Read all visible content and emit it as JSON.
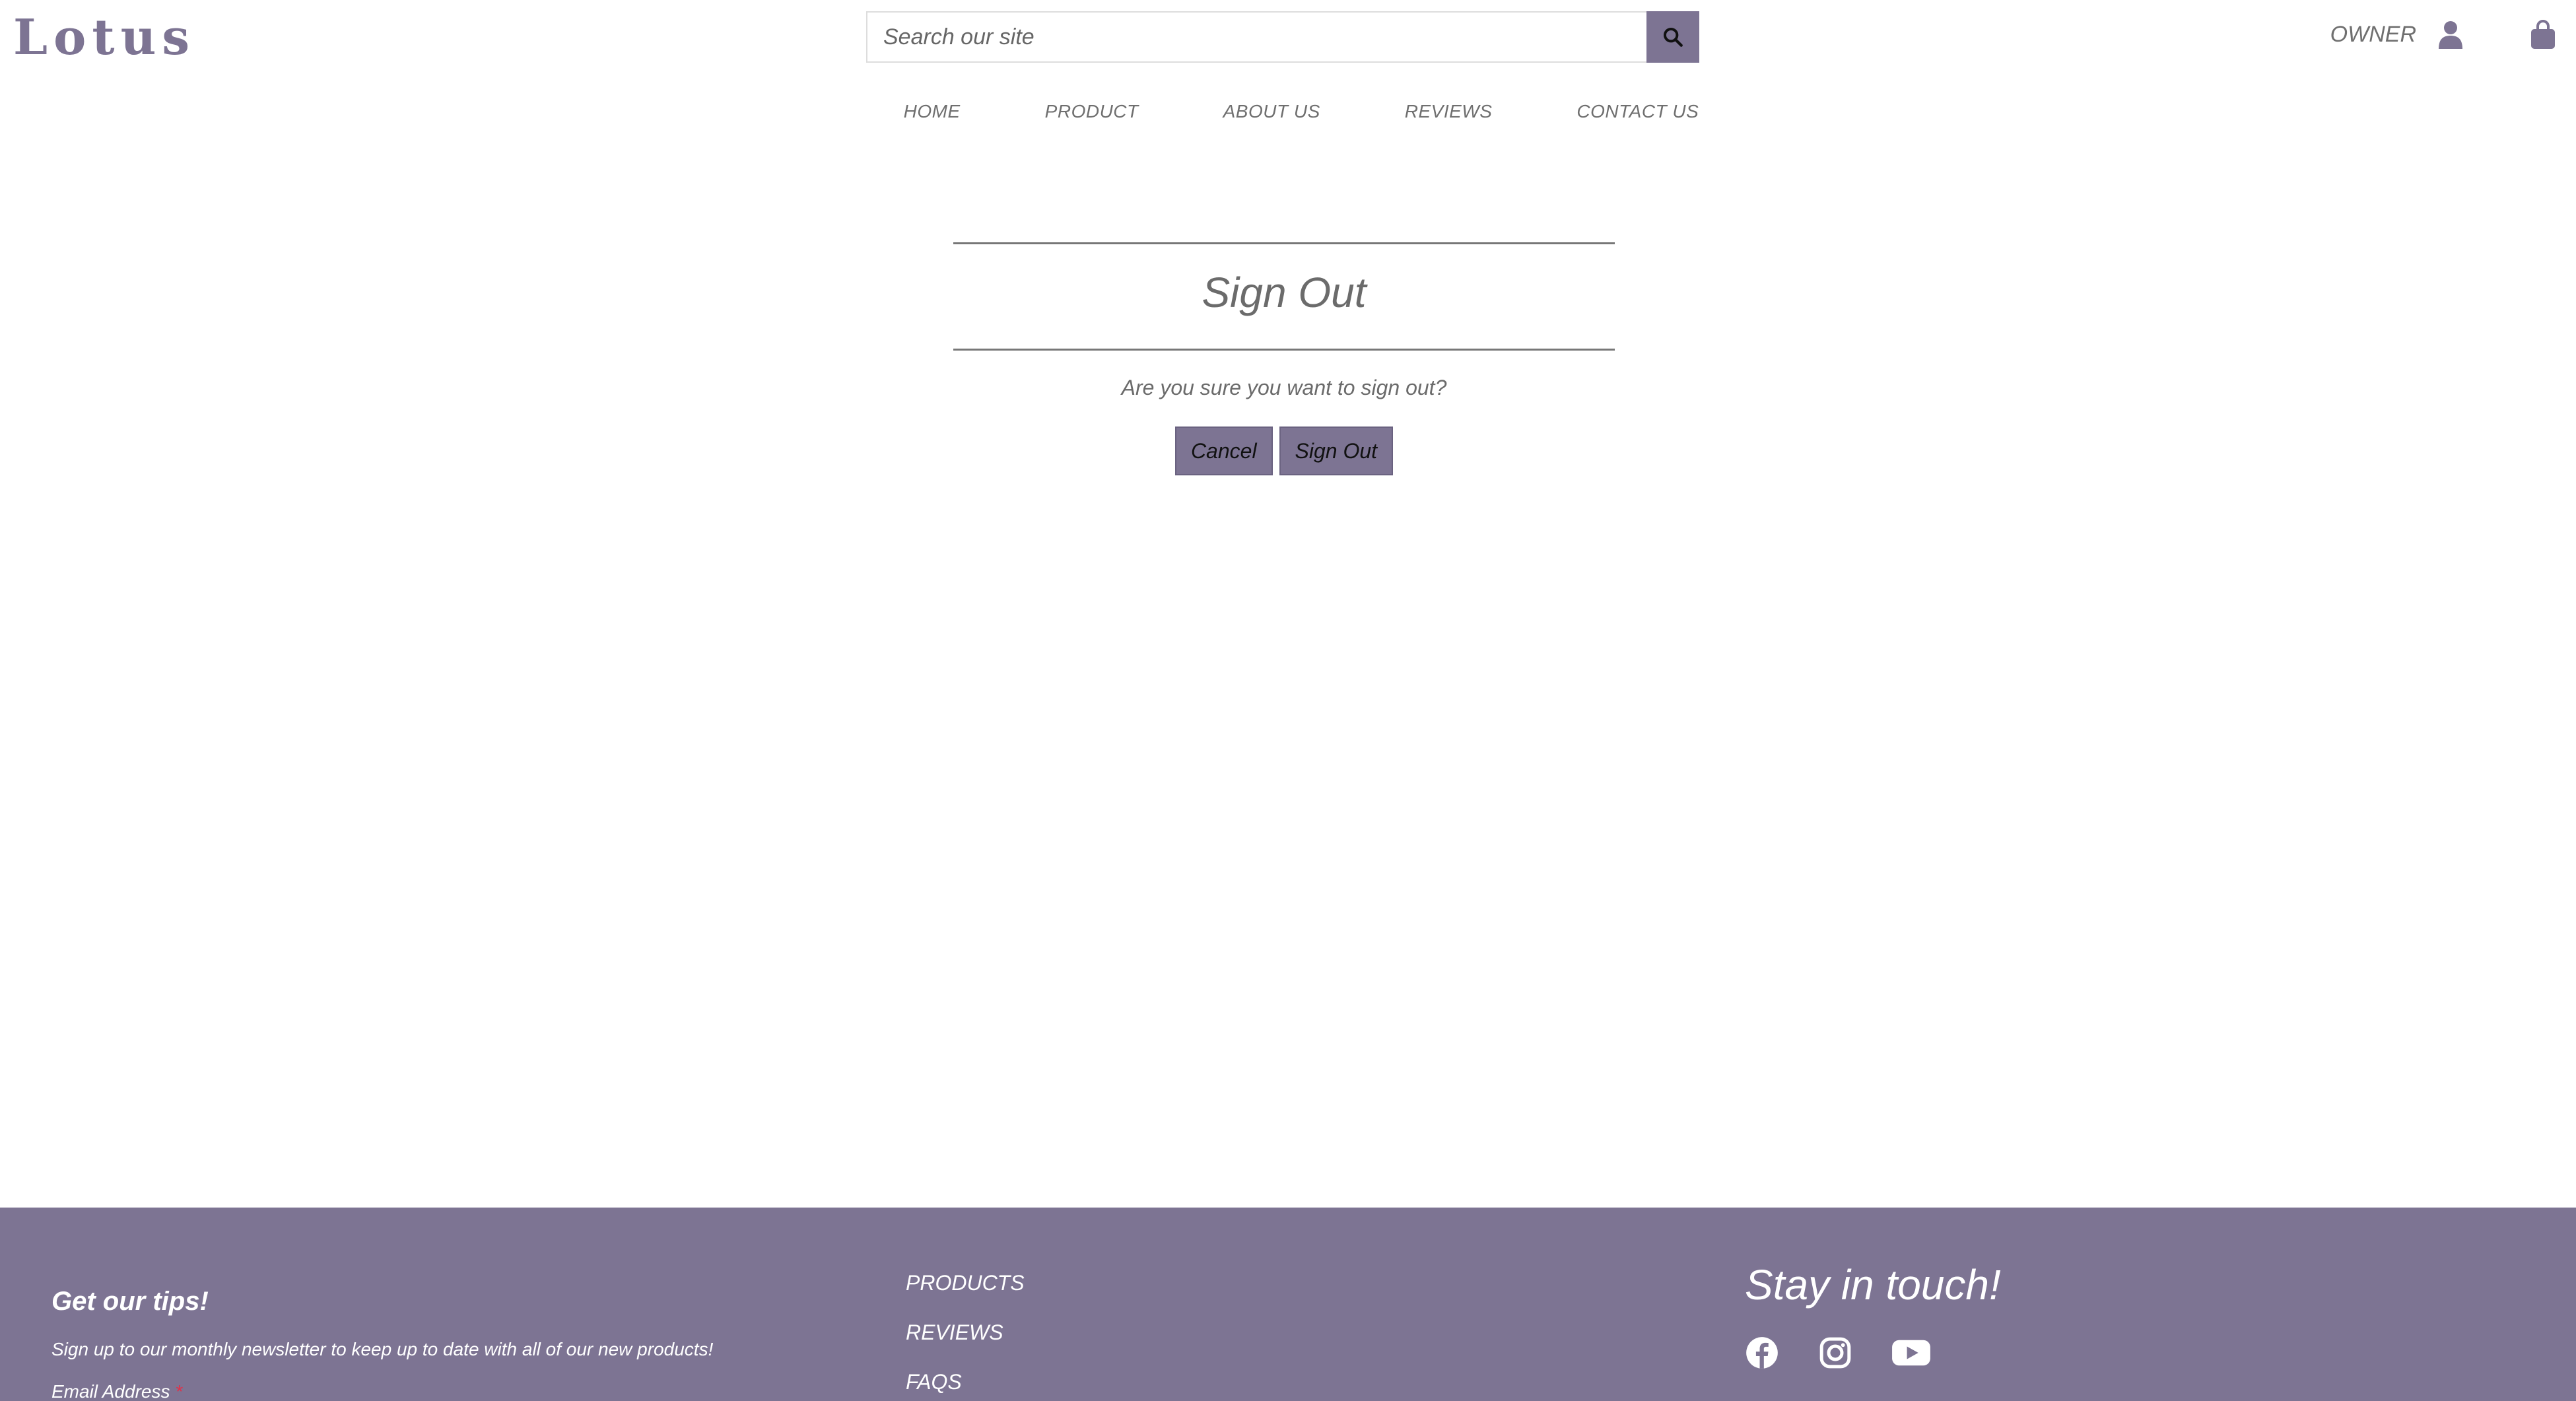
{
  "brand": {
    "logo": "Lotus"
  },
  "search": {
    "placeholder": "Search our site"
  },
  "account": {
    "label": "OWNER"
  },
  "nav": {
    "items": [
      "HOME",
      "PRODUCT",
      "ABOUT US",
      "REVIEWS",
      "CONTACT US"
    ]
  },
  "signout": {
    "title": "Sign Out",
    "question": "Are you sure you want to sign out?",
    "cancel_label": "Cancel",
    "confirm_label": "Sign Out"
  },
  "footer": {
    "newsletter_title": "Get our tips!",
    "newsletter_desc": "Sign up to our monthly newsletter to keep up to date with all of our new products!",
    "email_label": "Email Address",
    "required_mark": "*",
    "links": [
      "PRODUCTS",
      "REVIEWS",
      "FAQS"
    ],
    "social_title": "Stay in touch!",
    "social_icons": [
      "facebook-icon",
      "instagram-icon",
      "youtube-icon"
    ]
  },
  "colors": {
    "accent": "#7d7493",
    "text": "#6b6b6b",
    "footer_text": "#ffffff",
    "required": "#e0314a"
  }
}
